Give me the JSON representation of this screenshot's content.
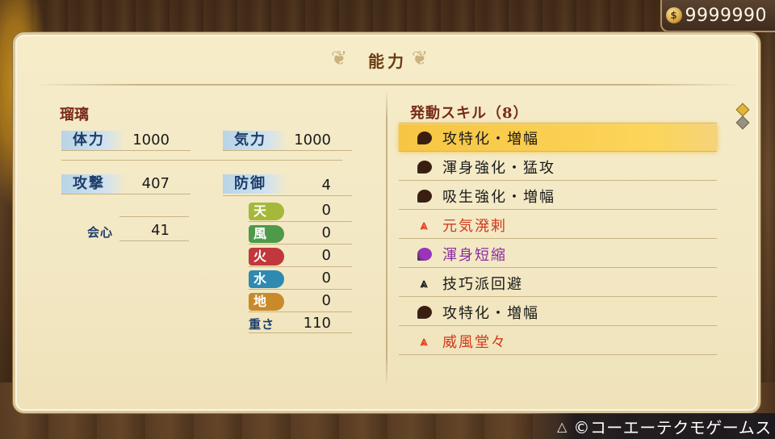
{
  "currency": {
    "amount": "9999990",
    "icon": "coin-icon"
  },
  "panel": {
    "title": "能力"
  },
  "character": {
    "name": "瑠璃"
  },
  "stats": {
    "hp": {
      "label": "体力",
      "value": "1000"
    },
    "ki": {
      "label": "気力",
      "value": "1000"
    },
    "attack": {
      "label": "攻撃",
      "value": "407"
    },
    "defense": {
      "label": "防御",
      "value": "4"
    },
    "critical": {
      "label": "会心",
      "value": "41"
    },
    "weight": {
      "label": "重さ",
      "value": "110"
    }
  },
  "elements": [
    {
      "label": "天",
      "value": "0",
      "color": "#a5b83a"
    },
    {
      "label": "風",
      "value": "0",
      "color": "#4e9a4a"
    },
    {
      "label": "火",
      "value": "0",
      "color": "#c0373c"
    },
    {
      "label": "水",
      "value": "0",
      "color": "#2e8ab0"
    },
    {
      "label": "地",
      "value": "0",
      "color": "#c98a2a"
    }
  ],
  "skills": {
    "title": "発動スキル（8）",
    "items": [
      {
        "label": "攻特化・増幅",
        "icon": "dark-orb-icon",
        "color": "#1a1a1a",
        "icon_color": "#3a1e10",
        "selected": true
      },
      {
        "label": "渾身強化・猛攻",
        "icon": "dark-orb-icon",
        "color": "#1a1a1a",
        "icon_color": "#3a1e10",
        "selected": false
      },
      {
        "label": "吸生強化・増幅",
        "icon": "dark-orb-icon",
        "color": "#1a1a1a",
        "icon_color": "#3a1e10",
        "selected": false
      },
      {
        "label": "元気溌剌",
        "icon": "red-chevron-icon",
        "color": "#d03a1c",
        "icon_color": "#e0401e",
        "selected": false
      },
      {
        "label": "渾身短縮",
        "icon": "purple-orb-icon",
        "color": "#8a2aa0",
        "icon_color": "#9a34b8",
        "selected": false
      },
      {
        "label": "技巧派回避",
        "icon": "black-chevron-icon",
        "color": "#1a1a1a",
        "icon_color": "#1a1a1a",
        "selected": false
      },
      {
        "label": "攻特化・増幅",
        "icon": "dark-orb-icon",
        "color": "#1a1a1a",
        "icon_color": "#3a1e10",
        "selected": false
      },
      {
        "label": "威風堂々",
        "icon": "red-chevron-icon",
        "color": "#d03a1c",
        "icon_color": "#e0401e",
        "selected": false
      }
    ]
  },
  "footer": {
    "button_icon": "triangle-button-icon",
    "copyright": "©コーエーテクモゲームス"
  }
}
